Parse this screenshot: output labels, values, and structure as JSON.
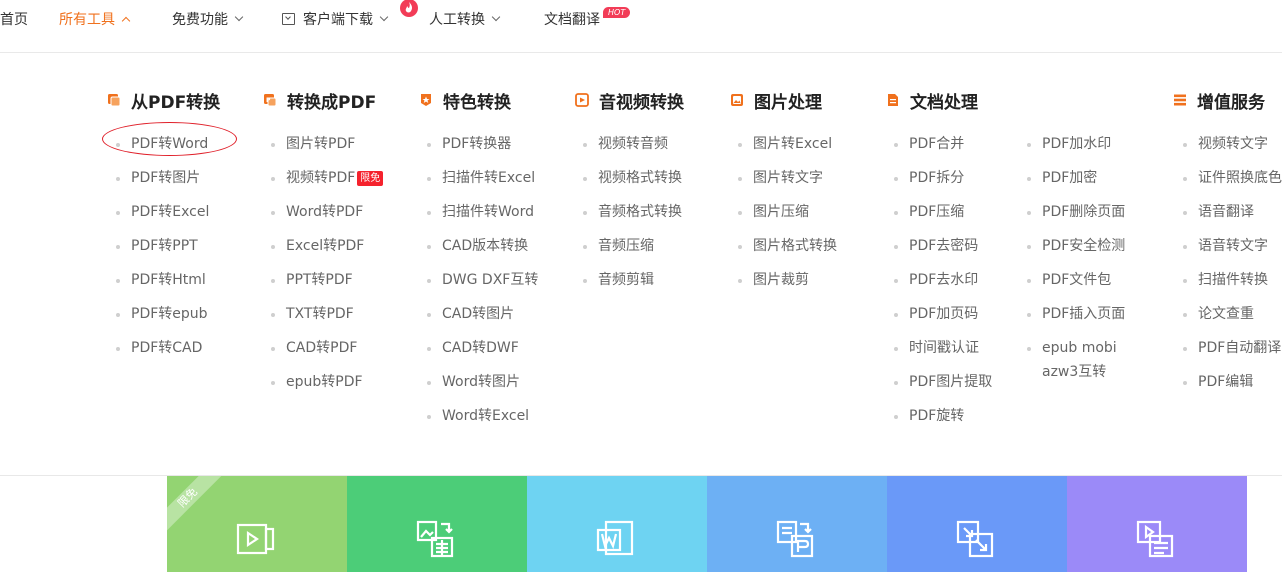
{
  "nav": {
    "home": "首页",
    "all_tools": "所有工具",
    "free": "免费功能",
    "client_download": "客户端下载",
    "manual": "人工转换",
    "translate": "文档翻译",
    "hot_badge": "HOT"
  },
  "columns": [
    {
      "title": "从PDF转换",
      "icon": "pdf-convert-icon",
      "color": "#f0711d",
      "items": [
        "PDF转Word",
        "PDF转图片",
        "PDF转Excel",
        "PDF转PPT",
        "PDF转Html",
        "PDF转epub",
        "PDF转CAD"
      ]
    },
    {
      "title": "转换成PDF",
      "icon": "to-pdf-icon",
      "color": "#f0711d",
      "items": [
        "图片转PDF",
        "视频转PDF",
        "Word转PDF",
        "Excel转PDF",
        "PPT转PDF",
        "TXT转PDF",
        "CAD转PDF",
        "epub转PDF"
      ],
      "badge": "限免"
    },
    {
      "title": "特色转换",
      "icon": "star-icon",
      "color": "#f0711d",
      "items": [
        "PDF转换器",
        "扫描件转Excel",
        "扫描件转Word",
        "CAD版本转换",
        "DWG DXF互转",
        "CAD转图片",
        "CAD转DWF",
        "Word转图片",
        "Word转Excel"
      ]
    },
    {
      "title": "音视频转换",
      "icon": "play-icon",
      "color": "#f0711d",
      "items": [
        "视频转音频",
        "视频格式转换",
        "音频格式转换",
        "音频压缩",
        "音频剪辑"
      ]
    },
    {
      "title": "图片处理",
      "icon": "image-icon",
      "color": "#f0711d",
      "items": [
        "图片转Excel",
        "图片转文字",
        "图片压缩",
        "图片格式转换",
        "图片裁剪"
      ]
    },
    {
      "title": "文档处理",
      "icon": "document-icon",
      "color": "#f0711d",
      "items": [
        "PDF合并",
        "PDF拆分",
        "PDF压缩",
        "PDF去密码",
        "PDF去水印",
        "PDF加页码",
        "时间戳认证",
        "PDF图片提取",
        "PDF旋转"
      ],
      "items2": [
        "PDF加水印",
        "PDF加密",
        "PDF删除页面",
        "PDF安全检测",
        "PDF文件包",
        "PDF插入页面",
        "epub mobi",
        "azw3互转"
      ]
    },
    {
      "title": "增值服务",
      "icon": "list-icon",
      "color": "#f0711d",
      "items": [
        "视频转文字",
        "证件照换底色",
        "语音翻译",
        "语音转文字",
        "扫描件转换",
        "论文查重",
        "PDF自动翻译",
        "PDF编辑"
      ]
    }
  ],
  "tiles": [
    {
      "color": "#93d472",
      "icon": "video-to-pdf-tile-icon",
      "ribbon": "限免"
    },
    {
      "color": "#4ccd78",
      "icon": "image-to-excel-tile-icon"
    },
    {
      "color": "#6ed3f2",
      "icon": "word-tile-icon"
    },
    {
      "color": "#6db0f4",
      "icon": "pdf-convert-tile-icon"
    },
    {
      "color": "#6a99f8",
      "icon": "compress-tile-icon"
    },
    {
      "color": "#9b8af8",
      "icon": "video-to-doc-tile-icon"
    }
  ]
}
